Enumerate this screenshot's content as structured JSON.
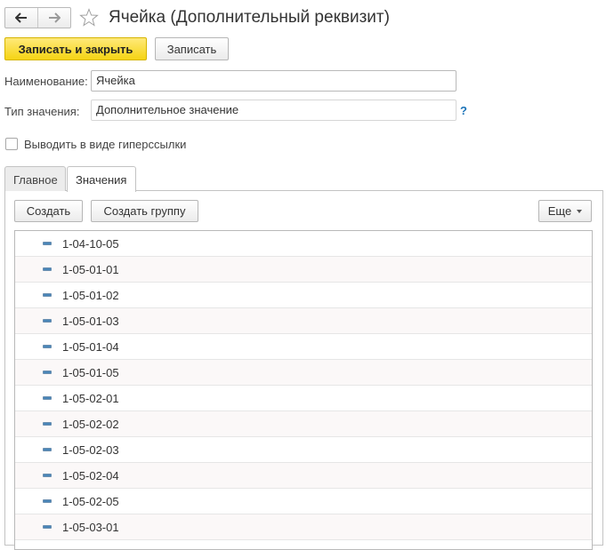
{
  "window": {
    "title": "Ячейка (Дополнительный реквизит)"
  },
  "nav": {
    "back_icon": "arrow-left-icon",
    "forward_icon": "arrow-right-icon",
    "favorite_icon": "star-icon"
  },
  "toolbar": {
    "save_close_label": "Записать и закрыть",
    "save_label": "Записать"
  },
  "form": {
    "name_label": "Наименование:",
    "name_value": "Ячейка",
    "type_label": "Тип значения:",
    "type_value": "Дополнительное значение",
    "help_label": "?",
    "hyperlink_label": "Выводить в виде гиперссылки",
    "hyperlink_checked": false
  },
  "tabs": [
    {
      "label": "Главное",
      "active": false
    },
    {
      "label": "Значения",
      "active": true
    }
  ],
  "values_toolbar": {
    "create_label": "Создать",
    "create_group_label": "Создать группу",
    "more_label": "Еще"
  },
  "values": [
    "1-04-10-05",
    "1-05-01-01",
    "1-05-01-02",
    "1-05-01-03",
    "1-05-01-04",
    "1-05-01-05",
    "1-05-02-01",
    "1-05-02-02",
    "1-05-02-03",
    "1-05-02-04",
    "1-05-02-05",
    "1-05-03-01"
  ],
  "colors": {
    "primary_button": "#f5d413",
    "help_link": "#1b73b8",
    "row_icon": "#4a86b8"
  }
}
